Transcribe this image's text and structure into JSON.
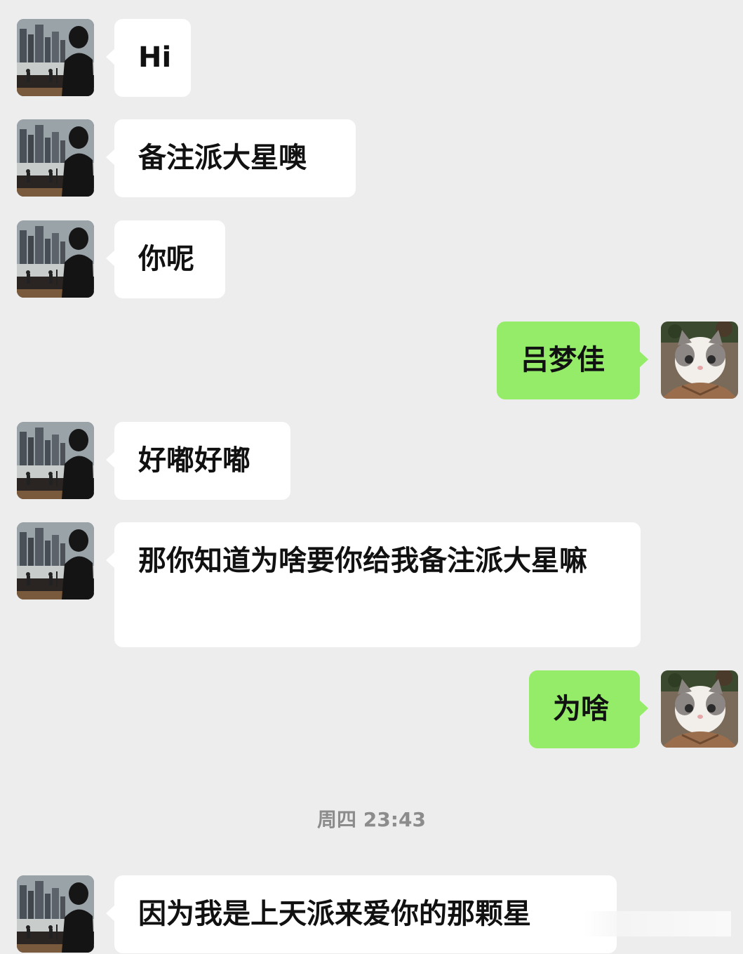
{
  "colors": {
    "background": "#ededed",
    "received_bubble": "#ffffff",
    "sent_bubble": "#95ec69",
    "text": "#111111",
    "timestamp": "#8c8c8c"
  },
  "contact_avatar_icon": "city-skyline-silhouette-avatar",
  "my_avatar_icon": "cat-avatar",
  "messages": [
    {
      "side": "received",
      "text": "Hi"
    },
    {
      "side": "received",
      "text": "备注派大星噢"
    },
    {
      "side": "received",
      "text": "你呢"
    },
    {
      "side": "sent",
      "text": "吕梦佳"
    },
    {
      "side": "received",
      "text": "好嘟好嘟"
    },
    {
      "side": "received",
      "text": "那你知道为啥要你给我备注派大星嘛"
    },
    {
      "side": "sent",
      "text": "为啥"
    },
    {
      "side": "received",
      "text": "因为我是上天派来爱你的那颗星"
    }
  ],
  "timestamp": "周四 23:43"
}
